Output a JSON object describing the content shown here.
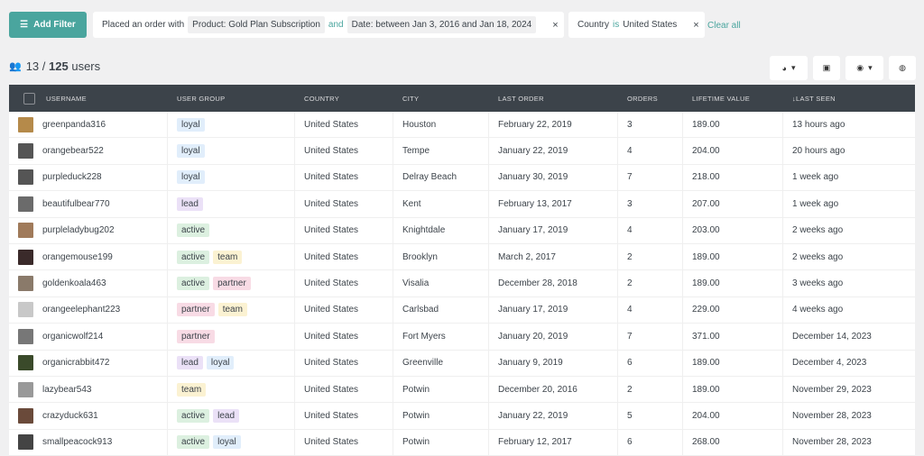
{
  "toolbar": {
    "add_filter": "Add Filter",
    "clear_all": "Clear all"
  },
  "filters": [
    {
      "prefix": "Placed an order with",
      "chip1": "Product: Gold Plan Subscription",
      "joiner": "and",
      "chip2": "Date: between Jan 3, 2016 and Jan 18, 2024",
      "close": "×"
    },
    {
      "field": "Country",
      "op": "is",
      "value": "United States",
      "close": "×"
    }
  ],
  "summary": {
    "shown": "13",
    "sep": " / ",
    "total": "125",
    "unit": "users"
  },
  "columns": [
    "USERNAME",
    "USER GROUP",
    "COUNTRY",
    "CITY",
    "LAST ORDER",
    "ORDERS",
    "LIFETIME VALUE",
    "↓LAST SEEN"
  ],
  "tag_colors": {
    "loyal": "#e1eefb",
    "lead": "#ebe1f7",
    "active": "#dcf0e0",
    "team": "#fbf2d2",
    "partner": "#f8dbe5"
  },
  "accent": "#4aa59e",
  "rows": [
    {
      "username": "greenpanda316",
      "groups": [
        "loyal"
      ],
      "country": "United States",
      "city": "Houston",
      "last_order": "February 22, 2019",
      "orders": "3",
      "ltv": "189.00",
      "last_seen": "13 hours ago",
      "avatar": "#b58a4a"
    },
    {
      "username": "orangebear522",
      "groups": [
        "loyal"
      ],
      "country": "United States",
      "city": "Tempe",
      "last_order": "January 22, 2019",
      "orders": "4",
      "ltv": "204.00",
      "last_seen": "20 hours ago",
      "avatar": "#555"
    },
    {
      "username": "purpleduck228",
      "groups": [
        "loyal"
      ],
      "country": "United States",
      "city": "Delray Beach",
      "last_order": "January 30, 2019",
      "orders": "7",
      "ltv": "218.00",
      "last_seen": "1 week ago",
      "avatar": "#555"
    },
    {
      "username": "beautifulbear770",
      "groups": [
        "lead"
      ],
      "country": "United States",
      "city": "Kent",
      "last_order": "February 13, 2017",
      "orders": "3",
      "ltv": "207.00",
      "last_seen": "1 week ago",
      "avatar": "#6b6b6b"
    },
    {
      "username": "purpleladybug202",
      "groups": [
        "active"
      ],
      "country": "United States",
      "city": "Knightdale",
      "last_order": "January 17, 2019",
      "orders": "4",
      "ltv": "203.00",
      "last_seen": "2 weeks ago",
      "avatar": "#a07a5a"
    },
    {
      "username": "orangemouse199",
      "groups": [
        "active",
        "team"
      ],
      "country": "United States",
      "city": "Brooklyn",
      "last_order": "March 2, 2017",
      "orders": "2",
      "ltv": "189.00",
      "last_seen": "2 weeks ago",
      "avatar": "#3a2a2a"
    },
    {
      "username": "goldenkoala463",
      "groups": [
        "active",
        "partner"
      ],
      "country": "United States",
      "city": "Visalia",
      "last_order": "December 28, 2018",
      "orders": "2",
      "ltv": "189.00",
      "last_seen": "3 weeks ago",
      "avatar": "#8a7a6a"
    },
    {
      "username": "orangeelephant223",
      "groups": [
        "partner",
        "team"
      ],
      "country": "United States",
      "city": "Carlsbad",
      "last_order": "January 17, 2019",
      "orders": "4",
      "ltv": "229.00",
      "last_seen": "4 weeks ago",
      "avatar": "#c8c8c8"
    },
    {
      "username": "organicwolf214",
      "groups": [
        "partner"
      ],
      "country": "United States",
      "city": "Fort Myers",
      "last_order": "January 20, 2019",
      "orders": "7",
      "ltv": "371.00",
      "last_seen": "December 14, 2023",
      "avatar": "#777"
    },
    {
      "username": "organicrabbit472",
      "groups": [
        "lead",
        "loyal"
      ],
      "country": "United States",
      "city": "Greenville",
      "last_order": "January 9, 2019",
      "orders": "6",
      "ltv": "189.00",
      "last_seen": "December 4, 2023",
      "avatar": "#3a4a2a"
    },
    {
      "username": "lazybear543",
      "groups": [
        "team"
      ],
      "country": "United States",
      "city": "Potwin",
      "last_order": "December 20, 2016",
      "orders": "2",
      "ltv": "189.00",
      "last_seen": "November 29, 2023",
      "avatar": "#999"
    },
    {
      "username": "crazyduck631",
      "groups": [
        "active",
        "lead"
      ],
      "country": "United States",
      "city": "Potwin",
      "last_order": "January 22, 2019",
      "orders": "5",
      "ltv": "204.00",
      "last_seen": "November 28, 2023",
      "avatar": "#6a4a3a"
    },
    {
      "username": "smallpeacock913",
      "groups": [
        "active",
        "loyal"
      ],
      "country": "United States",
      "city": "Potwin",
      "last_order": "February 12, 2017",
      "orders": "6",
      "ltv": "268.00",
      "last_seen": "November 28, 2023",
      "avatar": "#444"
    }
  ]
}
